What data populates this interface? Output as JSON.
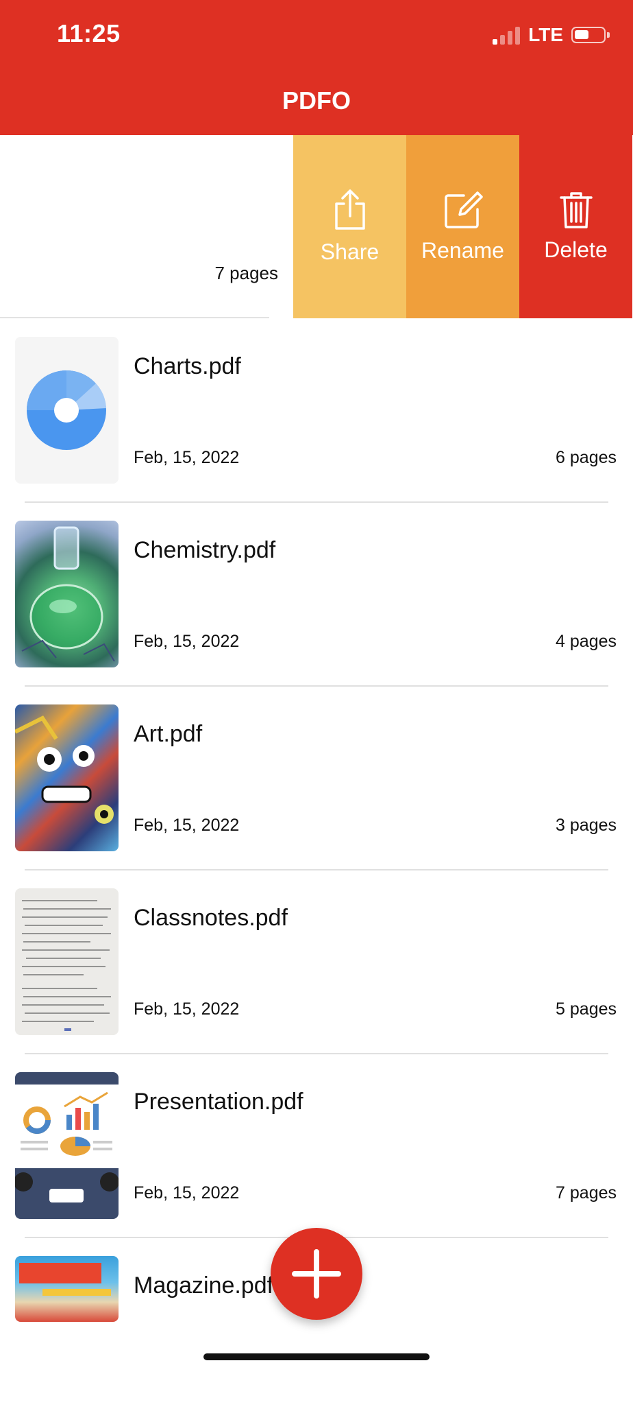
{
  "status_bar": {
    "time": "11:25",
    "network": "LTE"
  },
  "app": {
    "title": "PDFO"
  },
  "swiped_row": {
    "pages": "7 pages",
    "actions": [
      {
        "label": "Share",
        "icon": "share-icon",
        "color": "#f5c362"
      },
      {
        "label": "Rename",
        "icon": "rename-icon",
        "color": "#f09f3b"
      },
      {
        "label": "Delete",
        "icon": "trash-icon",
        "color": "#de3023"
      }
    ]
  },
  "files": [
    {
      "name": "Charts.pdf",
      "date": "Feb, 15, 2022",
      "pages": "6 pages",
      "thumb": "charts-thumbnail"
    },
    {
      "name": "Chemistry.pdf",
      "date": "Feb, 15, 2022",
      "pages": "4 pages",
      "thumb": "chemistry-thumbnail"
    },
    {
      "name": "Art.pdf",
      "date": "Feb, 15, 2022",
      "pages": "3 pages",
      "thumb": "art-thumbnail"
    },
    {
      "name": "Classnotes.pdf",
      "date": "Feb, 15, 2022",
      "pages": "5 pages",
      "thumb": "classnotes-thumbnail"
    },
    {
      "name": "Presentation.pdf",
      "date": "Feb, 15, 2022",
      "pages": "7 pages",
      "thumb": "presentation-thumbnail"
    },
    {
      "name": "Magazine.pdf",
      "thumb": "magazine-thumbnail"
    }
  ],
  "fab": {
    "icon": "plus-icon"
  },
  "colors": {
    "header": "#de3023",
    "accent": "#de3023"
  }
}
